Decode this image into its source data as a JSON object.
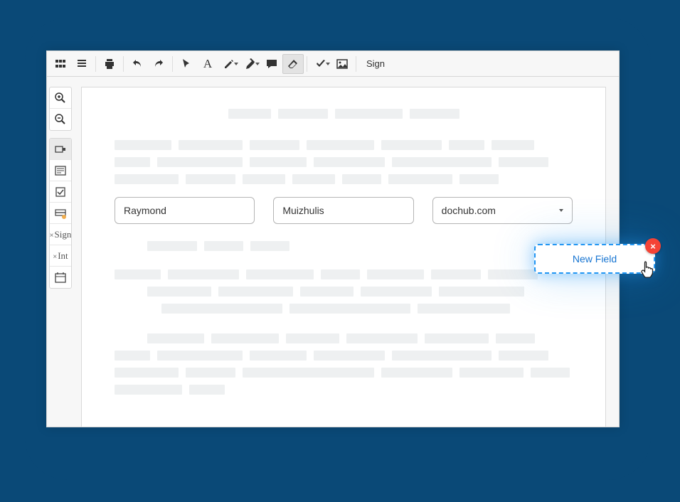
{
  "toolbar": {
    "sign_label": "Sign"
  },
  "fields": {
    "first_name": "Raymond",
    "last_name": "Muizhulis",
    "domain": "dochub.com"
  },
  "popup": {
    "new_field_label": "New Field"
  },
  "sidebar": {
    "sign_label": "Sign",
    "int_label": "Int"
  },
  "icons": {
    "grid": "grid-icon",
    "paragraph": "paragraph-icon",
    "print": "print-icon",
    "undo": "undo-icon",
    "redo": "redo-icon",
    "pointer": "pointer-icon",
    "text_a": "text-icon",
    "pen": "pen-icon",
    "highlight": "highlight-icon",
    "comment": "comment-icon",
    "eraser": "eraser-icon",
    "check": "check-icon",
    "image": "image-icon",
    "zoom_in": "zoom-in-icon",
    "zoom_out": "zoom-out-icon",
    "field_box": "textfield-box-icon",
    "doc_lines": "paragraph-box-icon",
    "checkbox": "checkbox-icon",
    "dropdown": "dropdown-field-icon",
    "calendar": "calendar-icon"
  }
}
